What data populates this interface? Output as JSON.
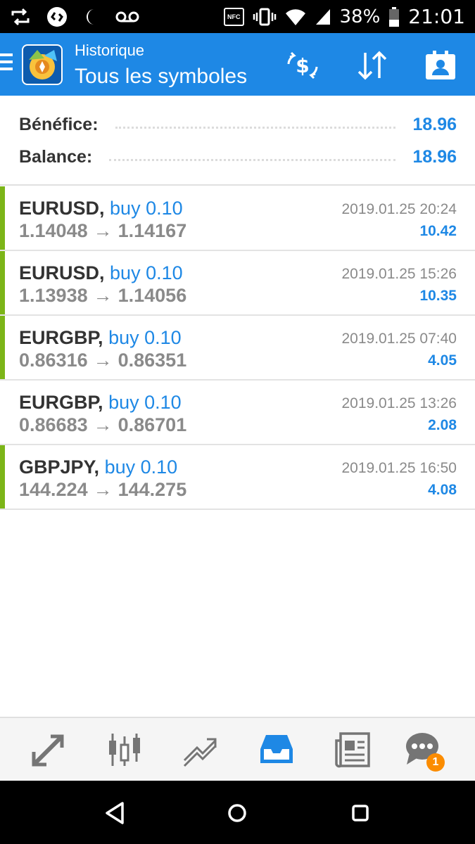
{
  "status_bar": {
    "battery": "38%",
    "time": "21:01",
    "nfc": "NFC"
  },
  "app_bar": {
    "title": "Historique",
    "subtitle": "Tous les symboles",
    "icons": [
      "menu-icon",
      "app-logo",
      "currency-exchange-icon",
      "sort-icon",
      "account-icon"
    ]
  },
  "summary": {
    "profit_label": "Bénéfice:",
    "profit_value": "18.96",
    "balance_label": "Balance:",
    "balance_value": "18.96"
  },
  "deals": [
    {
      "symbol": "EURUSD,",
      "side": "buy 0.10",
      "open": "1.14048",
      "close": "1.14167",
      "time": "2019.01.25 20:24",
      "profit": "10.42",
      "highlight": true
    },
    {
      "symbol": "EURUSD,",
      "side": "buy 0.10",
      "open": "1.13938",
      "close": "1.14056",
      "time": "2019.01.25 15:26",
      "profit": "10.35",
      "highlight": true
    },
    {
      "symbol": "EURGBP,",
      "side": "buy 0.10",
      "open": "0.86316",
      "close": "0.86351",
      "time": "2019.01.25 07:40",
      "profit": "4.05",
      "highlight": true
    },
    {
      "symbol": "EURGBP,",
      "side": "buy 0.10",
      "open": "0.86683",
      "close": "0.86701",
      "time": "2019.01.25 13:26",
      "profit": "2.08",
      "highlight": false
    },
    {
      "symbol": "GBPJPY,",
      "side": "buy 0.10",
      "open": "144.224",
      "close": "144.275",
      "time": "2019.01.25 16:50",
      "profit": "4.08",
      "highlight": true
    }
  ],
  "arrow_glyph": "→",
  "tab_bar": {
    "tabs": [
      "quotes-icon",
      "chart-icon",
      "trade-icon",
      "history-icon",
      "news-icon",
      "chat-icon"
    ],
    "active": "history-icon",
    "chat_badge": "1"
  },
  "colors": {
    "accent": "#1e88e5",
    "profit_bar": "#7cb518",
    "badge": "#fb8c00"
  }
}
